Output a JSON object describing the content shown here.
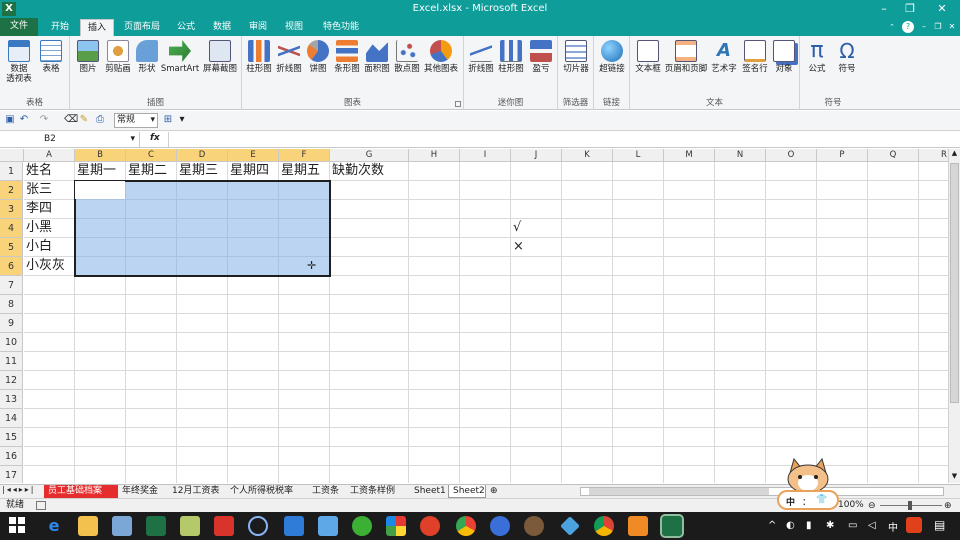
{
  "window": {
    "title": "Excel.xlsx - Microsoft Excel",
    "app_letter": "X"
  },
  "tabs": [
    {
      "label": "文件"
    },
    {
      "label": "开始"
    },
    {
      "label": "插入"
    },
    {
      "label": "页面布局"
    },
    {
      "label": "公式"
    },
    {
      "label": "数据"
    },
    {
      "label": "审阅"
    },
    {
      "label": "视图"
    },
    {
      "label": "特色功能"
    }
  ],
  "ribbon": {
    "groups": [
      {
        "label": "表格",
        "buttons": [
          "数据\n透视表",
          "表格"
        ]
      },
      {
        "label": "插图",
        "buttons": [
          "图片",
          "剪贴画",
          "形状",
          "SmartArt",
          "屏幕截图"
        ]
      },
      {
        "label": "图表",
        "buttons": [
          "柱形图",
          "折线图",
          "饼图",
          "条形图",
          "面积图",
          "散点图",
          "其他图表"
        ]
      },
      {
        "label": "迷你图",
        "buttons": [
          "折线图",
          "柱形图",
          "盈亏"
        ]
      },
      {
        "label": "筛选器",
        "buttons": [
          "切片器"
        ]
      },
      {
        "label": "链接",
        "buttons": [
          "超链接"
        ]
      },
      {
        "label": "文本",
        "buttons": [
          "文本框",
          "页眉和页脚",
          "艺术字",
          "签名行",
          "对象"
        ]
      },
      {
        "label": "符号",
        "buttons": [
          "公式",
          "符号"
        ]
      }
    ]
  },
  "qat": {
    "number_format": "常规"
  },
  "formula_bar": {
    "name_box": "B2",
    "fx": "fx",
    "value": ""
  },
  "columns": [
    "A",
    "B",
    "C",
    "D",
    "E",
    "F",
    "G",
    "H",
    "I",
    "J",
    "K",
    "L",
    "M",
    "N",
    "O",
    "P",
    "Q",
    "R"
  ],
  "rows": [
    "1",
    "2",
    "3",
    "4",
    "5",
    "6",
    "7",
    "8",
    "9",
    "10",
    "11",
    "12",
    "13",
    "14",
    "15",
    "16",
    "17"
  ],
  "cells": {
    "A1": "姓名",
    "B1": "星期一",
    "C1": "星期二",
    "D1": "星期三",
    "E1": "星期四",
    "F1": "星期五",
    "G1": "缺勤次数",
    "A2": "张三",
    "A3": "李四",
    "A4": "小黑",
    "A5": "小白",
    "A6": "小灰灰",
    "J4": "√",
    "J5": "×"
  },
  "sheet_tabs": [
    "员工基础档案",
    "年终奖金",
    "12月工资表",
    "个人所得税税率",
    "工资条",
    "工资条样例",
    "Sheet1",
    "Sheet2"
  ],
  "active_sheet": "Sheet2",
  "status": {
    "ready": "就绪",
    "zoom": "100%"
  },
  "taskbar": {
    "ime": "中",
    "time": ""
  }
}
